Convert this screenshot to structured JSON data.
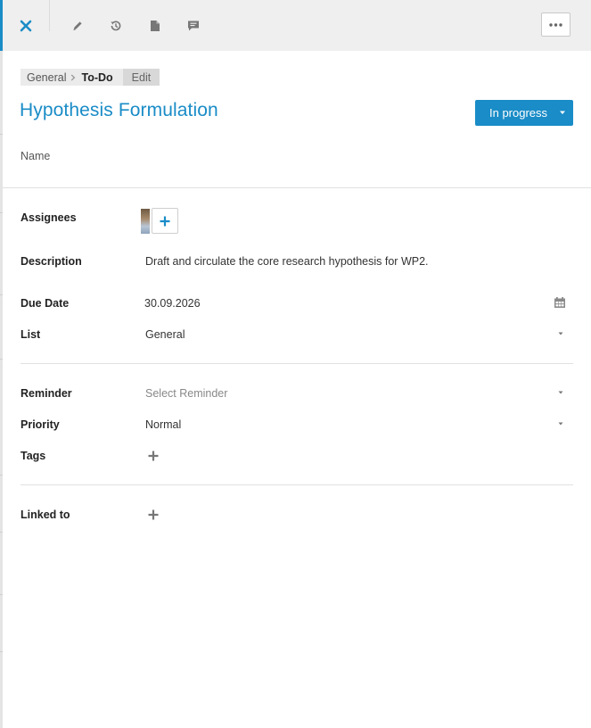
{
  "breadcrumb": {
    "root": "General",
    "current": "To-Do",
    "edit": "Edit"
  },
  "task": {
    "title": "Hypothesis Formulation",
    "status": "In progress",
    "name_label": "Name"
  },
  "fields": {
    "assignees": {
      "label": "Assignees"
    },
    "description": {
      "label": "Description",
      "value": "Draft and circulate the core research hypothesis for WP2."
    },
    "due_date": {
      "label": "Due Date",
      "value": "30.09.2026"
    },
    "list": {
      "label": "List",
      "value": "General"
    },
    "reminder": {
      "label": "Reminder",
      "placeholder": "Select Reminder"
    },
    "priority": {
      "label": "Priority",
      "value": "Normal"
    },
    "tags": {
      "label": "Tags"
    },
    "linked_to": {
      "label": "Linked to"
    }
  },
  "colors": {
    "accent": "#1a8cc7",
    "toolbar_bg": "#efefef"
  },
  "icons": {
    "toolbar": [
      "close-icon",
      "pencil-icon",
      "history-icon",
      "document-icon",
      "comment-icon",
      "more-icon"
    ],
    "fields": [
      "plus-icon",
      "calendar-icon",
      "caret-down-icon"
    ]
  }
}
